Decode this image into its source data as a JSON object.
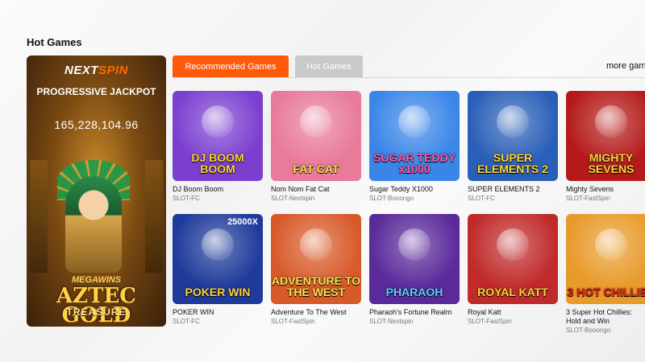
{
  "section_title": "Hot Games",
  "promo": {
    "brand_a": "NEXT",
    "brand_b": "SPIN",
    "jackpot_title": "PROGRESSIVE JACKPOT",
    "jackpot_value": "165,228,104.96",
    "logo_top": "MEGAWINS",
    "logo_main": "AZTEC GOLD",
    "logo_sub": "TREASURE"
  },
  "tabs": [
    {
      "label": "Recommended Games",
      "active": true
    },
    {
      "label": "Hot Games",
      "active": false
    }
  ],
  "more_label": "more gam",
  "games": [
    {
      "name": "DJ Boom Boom",
      "provider": "SLOT-FC",
      "logo": "DJ BOOM BOOM",
      "bg": "#7b3fd0",
      "logo_color": "#ffd43a"
    },
    {
      "name": "Nom Nom Fat Cat",
      "provider": "SLOT-Nextspin",
      "logo": "FAT CAT",
      "bg": "#e87a9a",
      "logo_color": "#ffe14a"
    },
    {
      "name": "Sugar Teddy X1000",
      "provider": "SLOT-Booongo",
      "logo": "SUGAR TEDDY x1000",
      "bg": "#3a86e8",
      "logo_color": "#ff5ab0"
    },
    {
      "name": "SUPER ELEMENTS 2",
      "provider": "SLOT-FC",
      "logo": "SUPER ELEMENTS 2",
      "bg": "#2a5fb8",
      "logo_color": "#ffd43a"
    },
    {
      "name": "Mighty Sevens",
      "provider": "SLOT-FastSpin",
      "logo": "MIGHTY SEVENS",
      "bg": "#b51a1a",
      "logo_color": "#ffd43a"
    },
    {
      "name": "POKER WIN",
      "provider": "SLOT-FC",
      "logo": "POKER WIN",
      "bg": "#1e3a9a",
      "logo_color": "#ffd43a",
      "badge": "25000X"
    },
    {
      "name": "Adventure To The West",
      "provider": "SLOT-FastSpin",
      "logo": "ADVENTURE TO THE WEST",
      "bg": "#d85a2a",
      "logo_color": "#ffe14a"
    },
    {
      "name": "Pharaoh's Fortune Realm",
      "provider": "SLOT-Nextspin",
      "logo": "PHARAOH",
      "bg": "#5a2a9a",
      "logo_color": "#5ad0ff"
    },
    {
      "name": "Royal Katt",
      "provider": "SLOT-FastSpin",
      "logo": "ROYAL KATT",
      "bg": "#c02a2a",
      "logo_color": "#ffd43a"
    },
    {
      "name": "3 Super Hot Chillies: Hold and Win",
      "provider": "SLOT-Booongo",
      "logo": "3 HOT CHILLIES",
      "bg": "#e89a2a",
      "logo_color": "#e8201a"
    }
  ]
}
